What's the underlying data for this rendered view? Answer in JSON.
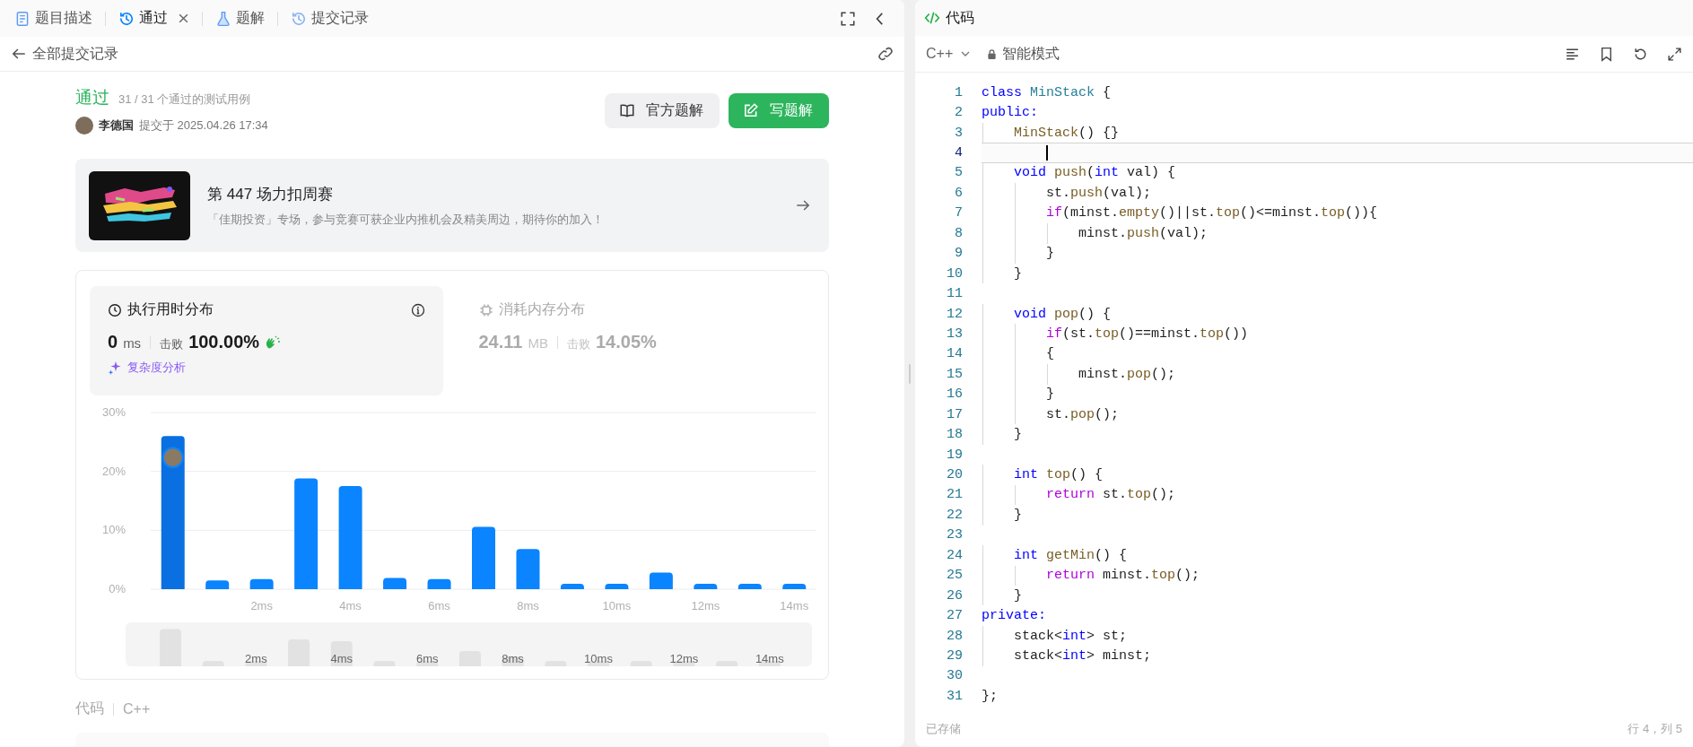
{
  "tabs": [
    {
      "label": "题目描述",
      "kind": "doc",
      "selected": false,
      "closable": false
    },
    {
      "label": "通过",
      "kind": "history",
      "selected": true,
      "closable": true
    },
    {
      "label": "题解",
      "kind": "flask",
      "selected": false,
      "closable": false
    },
    {
      "label": "提交记录",
      "kind": "history",
      "selected": false,
      "closable": false
    }
  ],
  "back_label": "全部提交记录",
  "result": {
    "status": "通过",
    "cases": "31 / 31 个通过的测试用例",
    "user": "李德国",
    "submitted": "提交于 2025.04.26 17:34"
  },
  "buttons": [
    {
      "label": "官方题解",
      "kind": "secondary"
    },
    {
      "label": "写题解",
      "kind": "primary"
    }
  ],
  "banner": {
    "title": "第 447 场力扣周赛",
    "description": "「佳期投资」专场，参与竞赛可获企业内推机会及精美周边，期待你的加入！"
  },
  "panels": [
    {
      "kind": "time",
      "title": "执行用时分布",
      "value": "0",
      "unit": "ms",
      "beat_label": "击败",
      "beat": "100.00%",
      "selected": true,
      "link": "复杂度分析"
    },
    {
      "kind": "memory",
      "title": "消耗内存分布",
      "value": "24.11",
      "unit": "MB",
      "beat_label": "击败",
      "beat": "14.05%",
      "selected": false
    }
  ],
  "chart_data": {
    "type": "bar",
    "x": [
      0,
      1,
      2,
      3,
      4,
      5,
      6,
      7,
      8,
      9,
      10,
      11,
      12,
      13,
      14
    ],
    "values": [
      26,
      1.5,
      1.7,
      18.8,
      17.5,
      1.9,
      1.7,
      10.6,
      6.8,
      0.9,
      0.9,
      2.8,
      0.9,
      0.9,
      0.9
    ],
    "xlim": [
      -0.5,
      14.5
    ],
    "ylim": [
      0,
      30
    ],
    "yticks": [
      {
        "value": 0,
        "label": "0%"
      },
      {
        "value": 10,
        "label": "10%"
      },
      {
        "value": 20,
        "label": "20%"
      },
      {
        "value": 30,
        "label": "30%"
      }
    ],
    "xticks": [
      {
        "value": 2,
        "label": "2ms"
      },
      {
        "value": 4,
        "label": "4ms"
      },
      {
        "value": 6,
        "label": "6ms"
      },
      {
        "value": 8,
        "label": "8ms"
      },
      {
        "value": 10,
        "label": "10ms"
      },
      {
        "value": 12,
        "label": "12ms"
      },
      {
        "value": 14,
        "label": "14ms"
      }
    ]
  },
  "navigator_labels": [
    "2ms",
    "4ms",
    "6ms",
    "8ms",
    "10ms",
    "12ms",
    "14ms"
  ],
  "code_section": {
    "title": "代码",
    "language": "C++"
  },
  "editor": {
    "title": "代码",
    "language": "C++",
    "mode": "智能模式",
    "saved": "已存储",
    "position": "行 4，列 5",
    "lines": [
      {
        "no": "1",
        "active": false,
        "tokens": [
          {
            "kind": "kw",
            "text": "class "
          },
          {
            "kind": "type",
            "text": "MinStack"
          },
          {
            "kind": "p",
            "text": " {"
          }
        ]
      },
      {
        "no": "2",
        "active": false,
        "tokens": [
          {
            "kind": "kw",
            "text": "public:"
          }
        ]
      },
      {
        "no": "3",
        "active": false,
        "tokens": [
          {
            "kind": "fn",
            "text": "    MinStack"
          },
          {
            "kind": "p",
            "text": "() {}"
          }
        ]
      },
      {
        "no": "4",
        "active": true
      },
      {
        "no": "5",
        "active": false,
        "tokens": [
          {
            "kind": "kw",
            "text": "    void "
          },
          {
            "kind": "fn",
            "text": "push"
          },
          {
            "kind": "p",
            "text": "("
          },
          {
            "kind": "kw",
            "text": "int"
          },
          {
            "kind": "p",
            "text": " val) {"
          }
        ]
      },
      {
        "no": "6",
        "active": false,
        "tokens": [
          {
            "kind": "p",
            "text": "        st."
          },
          {
            "kind": "fn",
            "text": "push"
          },
          {
            "kind": "p",
            "text": "(val);"
          }
        ]
      },
      {
        "no": "7",
        "active": false,
        "tokens": [
          {
            "kind": "ctrl",
            "text": "        if"
          },
          {
            "kind": "p",
            "text": "(minst."
          },
          {
            "kind": "fn",
            "text": "empty"
          },
          {
            "kind": "p",
            "text": "()||st."
          },
          {
            "kind": "fn",
            "text": "top"
          },
          {
            "kind": "p",
            "text": "()<=minst."
          },
          {
            "kind": "fn",
            "text": "top"
          },
          {
            "kind": "p",
            "text": "()){"
          }
        ]
      },
      {
        "no": "8",
        "active": false,
        "tokens": [
          {
            "kind": "p",
            "text": "            minst."
          },
          {
            "kind": "fn",
            "text": "push"
          },
          {
            "kind": "p",
            "text": "(val);"
          }
        ]
      },
      {
        "no": "9",
        "active": false,
        "tokens": [
          {
            "kind": "p",
            "text": "        }"
          }
        ]
      },
      {
        "no": "10",
        "active": false,
        "tokens": [
          {
            "kind": "p",
            "text": "    }"
          }
        ]
      },
      {
        "no": "11",
        "active": false
      },
      {
        "no": "12",
        "active": false,
        "tokens": [
          {
            "kind": "kw",
            "text": "    void "
          },
          {
            "kind": "fn",
            "text": "pop"
          },
          {
            "kind": "p",
            "text": "() {"
          }
        ]
      },
      {
        "no": "13",
        "active": false,
        "tokens": [
          {
            "kind": "ctrl",
            "text": "        if"
          },
          {
            "kind": "p",
            "text": "(st."
          },
          {
            "kind": "fn",
            "text": "top"
          },
          {
            "kind": "p",
            "text": "()==minst."
          },
          {
            "kind": "fn",
            "text": "top"
          },
          {
            "kind": "p",
            "text": "())"
          }
        ]
      },
      {
        "no": "14",
        "active": false,
        "tokens": [
          {
            "kind": "p",
            "text": "        {"
          }
        ]
      },
      {
        "no": "15",
        "active": false,
        "tokens": [
          {
            "kind": "p",
            "text": "            minst."
          },
          {
            "kind": "fn",
            "text": "pop"
          },
          {
            "kind": "p",
            "text": "();"
          }
        ]
      },
      {
        "no": "16",
        "active": false,
        "tokens": [
          {
            "kind": "p",
            "text": "        }"
          }
        ]
      },
      {
        "no": "17",
        "active": false,
        "tokens": [
          {
            "kind": "p",
            "text": "        st."
          },
          {
            "kind": "fn",
            "text": "pop"
          },
          {
            "kind": "p",
            "text": "();"
          }
        ]
      },
      {
        "no": "18",
        "active": false,
        "tokens": [
          {
            "kind": "p",
            "text": "    }"
          }
        ]
      },
      {
        "no": "19",
        "active": false
      },
      {
        "no": "20",
        "active": false,
        "tokens": [
          {
            "kind": "kw",
            "text": "    int "
          },
          {
            "kind": "fn",
            "text": "top"
          },
          {
            "kind": "p",
            "text": "() {"
          }
        ]
      },
      {
        "no": "21",
        "active": false,
        "tokens": [
          {
            "kind": "ctrl",
            "text": "        return"
          },
          {
            "kind": "p",
            "text": " st."
          },
          {
            "kind": "fn",
            "text": "top"
          },
          {
            "kind": "p",
            "text": "();"
          }
        ]
      },
      {
        "no": "22",
        "active": false,
        "tokens": [
          {
            "kind": "p",
            "text": "    }"
          }
        ]
      },
      {
        "no": "23",
        "active": false
      },
      {
        "no": "24",
        "active": false,
        "tokens": [
          {
            "kind": "kw",
            "text": "    int "
          },
          {
            "kind": "fn",
            "text": "getMin"
          },
          {
            "kind": "p",
            "text": "() {"
          }
        ]
      },
      {
        "no": "25",
        "active": false,
        "tokens": [
          {
            "kind": "ctrl",
            "text": "        return"
          },
          {
            "kind": "p",
            "text": " minst."
          },
          {
            "kind": "fn",
            "text": "top"
          },
          {
            "kind": "p",
            "text": "();"
          }
        ]
      },
      {
        "no": "26",
        "active": false,
        "tokens": [
          {
            "kind": "p",
            "text": "    }"
          }
        ]
      },
      {
        "no": "27",
        "active": false,
        "tokens": [
          {
            "kind": "kw",
            "text": "private:"
          }
        ]
      },
      {
        "no": "28",
        "active": false,
        "tokens": [
          {
            "kind": "p",
            "text": "    stack<"
          },
          {
            "kind": "kw",
            "text": "int"
          },
          {
            "kind": "p",
            "text": "> st;"
          }
        ]
      },
      {
        "no": "29",
        "active": false,
        "tokens": [
          {
            "kind": "p",
            "text": "    stack<"
          },
          {
            "kind": "kw",
            "text": "int"
          },
          {
            "kind": "p",
            "text": "> minst;"
          }
        ]
      },
      {
        "no": "30",
        "active": false
      },
      {
        "no": "31",
        "active": false,
        "tokens": [
          {
            "kind": "p",
            "text": "};"
          }
        ]
      }
    ]
  }
}
